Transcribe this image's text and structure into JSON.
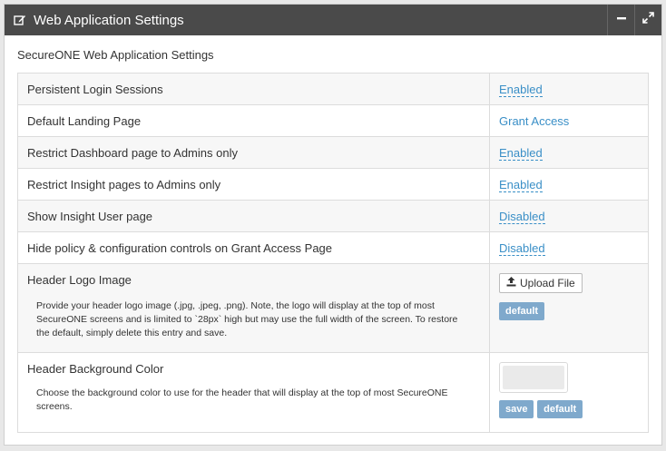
{
  "panel": {
    "title": "Web Application Settings",
    "icons": {
      "edit": "edit-icon",
      "minimize": "minimize-icon",
      "fullscreen": "fullscreen-icon"
    }
  },
  "section_title": "SecureONE Web Application Settings",
  "rows": [
    {
      "label": "Persistent Login Sessions",
      "value": "Enabled"
    },
    {
      "label": "Default Landing Page",
      "value": "Grant Access"
    },
    {
      "label": "Restrict Dashboard page to Admins only",
      "value": "Enabled"
    },
    {
      "label": "Restrict Insight pages to Admins only",
      "value": "Enabled"
    },
    {
      "label": "Show Insight User page",
      "value": "Disabled"
    },
    {
      "label": "Hide policy & configuration controls on Grant Access Page",
      "value": "Disabled"
    }
  ],
  "header_logo": {
    "label": "Header Logo Image",
    "help": "Provide your header logo image (.jpg, .jpeg, .png). Note, the logo will display at the top of most SecureONE screens and is limited to `28px` high but may use the full width of the screen. To restore the default, simply delete this entry and save.",
    "upload_label": "Upload File",
    "default_label": "default"
  },
  "header_bg": {
    "label": "Header Background Color",
    "help": "Choose the background color to use for the header that will display at the top of most SecureONE screens.",
    "color": "#eaeaea",
    "save_label": "save",
    "default_label": "default"
  }
}
